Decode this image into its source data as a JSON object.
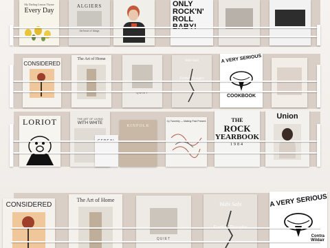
{
  "books": {
    "every_day_small": "My Darling Lemon Thyme",
    "every_day_title": "Every Day",
    "algiers": "ALGIERS",
    "algiers_sub": "the heart of things",
    "only_rock": "ONLY ROCK'N' ROLL BABY!",
    "considered": "CONSIDERED",
    "art_of_home": "The Art of Home",
    "quiet": "QUIET",
    "wabi_sabi": "Wabi Sabi",
    "further_thoughts": "Further Thoughts",
    "very_serious": "A VERY SERIOUS",
    "cookbook": "COOKBOOK",
    "wildair": "Contra Wildair",
    "loriot": "LORIOT",
    "living_white_small": "THE ART OF LIVING",
    "living_white": "WITH WHITE",
    "kinfolk": "KINFOLK",
    "cereal": "CEREAL",
    "twombly": "Cy Twombly — Making Past Present",
    "rock_yearbook_1": "THE",
    "rock_yearbook_2": "ROCK",
    "rock_yearbook_3": "YEARBOOK",
    "rock_year": "1984",
    "union": "Union"
  },
  "colors": {
    "backing": "#d9cfc6",
    "rail": "#fafafa",
    "wall": "#f2eeea"
  }
}
